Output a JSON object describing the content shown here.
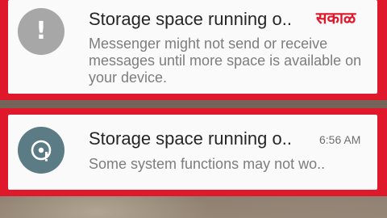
{
  "notifications": [
    {
      "title": "Storage space running o..",
      "body": "Messenger might not send or receive messages until more space is available on your device.",
      "icon": "exclamation-icon",
      "icon_color": "#a7a7a7"
    },
    {
      "title": "Storage space running o..",
      "time": "6:56 AM",
      "body": "Some system functions may not wo..",
      "icon": "storage-disk-icon",
      "icon_color": "#5b7c85"
    }
  ],
  "watermark": {
    "text": "सकाळ"
  },
  "colors": {
    "highlight_border": "#e0182b",
    "card_background": "#fafafa"
  }
}
